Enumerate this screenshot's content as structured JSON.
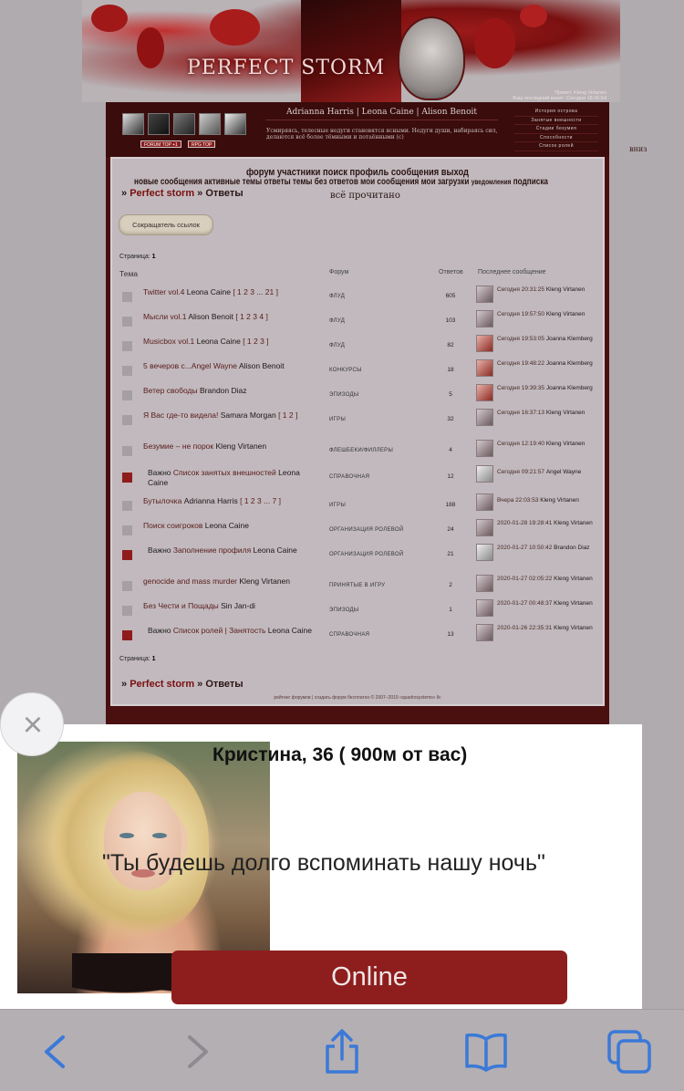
{
  "header": {
    "logo_text": "PERFECT STORM",
    "user_line1": "Привет, Kleng Virtanen",
    "user_line2": "Ваш последний визит: Сегодня 18:30:54"
  },
  "topbar": {
    "badge1": "FORUM TOP  +1",
    "badge2": "RPG TOP",
    "names": "Adrianna Harris | Leona Caine | Alison Benoit",
    "tagline": "Усмиряясь, телесные недуги становятся ясными. Недуги души, набираясь сил, делаются всё более тёмными и потаёнными (с)",
    "menu": [
      "История острова",
      "Занятые внешности",
      "Стадии безумия",
      "Способности",
      "Список ролей"
    ]
  },
  "vniz": "вниз",
  "nav": {
    "row1": "форум  участники  поиск  профиль  сообщения  выход",
    "row2": "новые сообщения  активные темы  ответы  темы без ответов  мои сообщения  мои загрузки",
    "row2_small": "уведомления",
    "row2_end": "подписка"
  },
  "crumb": {
    "sep": "»",
    "forum": "Perfect storm",
    "current": "Ответы"
  },
  "all_read": "всё прочитано",
  "shortener_button": "Сокращатель ссылок",
  "page_label": "Страница:",
  "page_number": "1",
  "table_headers": {
    "topic": "Тема",
    "forum": "Форум",
    "replies": "Ответов",
    "last": "Последнее сообщение"
  },
  "rows": [
    {
      "title": "Twitter vol.4",
      "author": "Leona Caine",
      "pages": "[ 1 2 3 ... 21 ]",
      "forum": "ФЛУД",
      "replies": "605",
      "last_date": "Сегодня 20:31:25",
      "last_user": "Kleng Virtanen",
      "important": false,
      "avatar": "grey"
    },
    {
      "title": "Мысли vol.1",
      "author": "Alison Benoit",
      "pages": "[ 1 2 3 4 ]",
      "forum": "ФЛУД",
      "replies": "103",
      "last_date": "Сегодня 19:57:50",
      "last_user": "Kleng Virtanen",
      "important": false,
      "avatar": "grey"
    },
    {
      "title": "Musicbox vol.1",
      "author": "Leona Caine",
      "pages": "[ 1 2 3 ]",
      "forum": "ФЛУД",
      "replies": "82",
      "last_date": "Сегодня 19:53:05",
      "last_user": "Joanna Klemberg",
      "important": false,
      "avatar": "red"
    },
    {
      "title": "5 вечеров с...Angel Wayne",
      "author": "Alison Benoit",
      "pages": "",
      "forum": "КОНКУРСЫ",
      "replies": "18",
      "last_date": "Сегодня 19:48:22",
      "last_user": "Joanna Klemberg",
      "important": false,
      "avatar": "red"
    },
    {
      "title": "Ветер свободы",
      "author": "Brandon Diaz",
      "pages": "",
      "forum": "ЭПИЗОДЫ",
      "replies": "5",
      "last_date": "Сегодня 19:39:35",
      "last_user": "Joanna Klemberg",
      "important": false,
      "avatar": "red"
    },
    {
      "title": "Я Вас где-то видела!",
      "author": "Samara Morgan",
      "pages": "[ 1 2 ]",
      "forum": "ИГРЫ",
      "replies": "32",
      "last_date": "Сегодня 16:37:13",
      "last_user": "Kleng Virtanen",
      "important": false,
      "avatar": "grey"
    },
    {
      "title": "Безумие – не порок",
      "author": "Kleng Virtanen",
      "pages": "",
      "forum": "ФЛЕШБЕКИ/ФИЛЛЕРЫ",
      "replies": "4",
      "last_date": "Сегодня 12:19:40",
      "last_user": "Kleng Virtanen",
      "important": false,
      "avatar": "grey"
    },
    {
      "title": "Список занятых внешностей",
      "author": "Leona Caine",
      "pages": "",
      "forum": "СПРАВОЧНАЯ",
      "replies": "12",
      "last_date": "Сегодня 09:21:57",
      "last_user": "Angel Wayne",
      "important": true,
      "avatar": "light"
    },
    {
      "title": "Бутылочка",
      "author": "Adrianna Harris",
      "pages": "[ 1 2 3 ... 7 ]",
      "forum": "ИГРЫ",
      "replies": "188",
      "last_date": "Вчера 22:03:53",
      "last_user": "Kleng Virtanen",
      "important": false,
      "avatar": "grey"
    },
    {
      "title": "Поиск соигроков",
      "author": "Leona Caine",
      "pages": "",
      "forum": "ОРГАНИЗАЦИЯ РОЛЕВОЙ",
      "replies": "24",
      "last_date": "2020-01-28 19:28:41",
      "last_user": "Kleng Virtanen",
      "important": false,
      "avatar": "grey"
    },
    {
      "title": "Заполнение профиля",
      "author": "Leona Caine",
      "pages": "",
      "forum": "ОРГАНИЗАЦИЯ РОЛЕВОЙ",
      "replies": "21",
      "last_date": "2020-01-27 10:50:42",
      "last_user": "Brandon Diaz",
      "important": true,
      "avatar": "light"
    },
    {
      "title": "genocide and mass murder",
      "author": "Kleng Virtanen",
      "pages": "",
      "forum": "ПРИНЯТЫЕ В ИГРУ",
      "replies": "2",
      "last_date": "2020-01-27 02:05:22",
      "last_user": "Kleng Virtanen",
      "important": false,
      "avatar": "grey"
    },
    {
      "title": "Без Чести и Пощады",
      "author": "Sin Jan-di",
      "pages": "",
      "forum": "ЭПИЗОДЫ",
      "replies": "1",
      "last_date": "2020-01-27 00:48:37",
      "last_user": "Kleng Virtanen",
      "important": false,
      "avatar": "grey"
    },
    {
      "title": "Список ролей | Занятость",
      "author": "Leona Caine",
      "pages": "",
      "forum": "СПРАВОЧНАЯ",
      "replies": "13",
      "last_date": "2020-01-26 22:35:31",
      "last_user": "Kleng Virtanen",
      "important": true,
      "avatar": "grey"
    }
  ],
  "important_label": "Важно",
  "footer": "рейтинг форумов | создать форум бесплатно © 2007–2019 «quadrosystems» llc",
  "ad": {
    "title": "Кристина, 36 ( 900м от вас)",
    "quote": "\"Ты будешь долго вспоминать нашу ночь\"",
    "button": "Online",
    "accent": "#8e1e1e"
  },
  "toolbar": {
    "back": "back-icon",
    "forward": "forward-icon",
    "share": "share-icon",
    "bookmarks": "bookmarks-icon",
    "tabs": "tabs-icon",
    "active_color": "#3a79d8",
    "disabled_color": "#8e8a90"
  }
}
